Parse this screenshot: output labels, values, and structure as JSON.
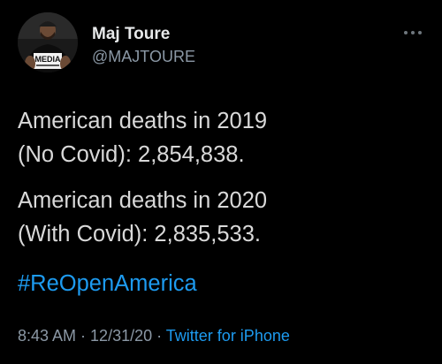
{
  "author": {
    "name": "Maj Toure",
    "handle": "@MAJTOURE",
    "avatar_icon": "profile-photo",
    "avatar_shirt_text": "MEDIA"
  },
  "more_icon": "ellipsis-icon",
  "tweet": {
    "paragraph1": {
      "line1": "American deaths in 2019",
      "line2": "(No Covid): 2,854,838."
    },
    "paragraph2": {
      "line1": "American deaths in 2020",
      "line2": "(With Covid): 2,835,533."
    },
    "hashtag": "#ReOpenAmerica"
  },
  "meta": {
    "time": "8:43 AM",
    "separator": " · ",
    "date": "12/31/20",
    "source": "Twitter for iPhone"
  },
  "colors": {
    "background": "#000000",
    "primary_text": "#e7e9ea",
    "secondary_text": "#8b98a5",
    "link": "#1d9bf0"
  }
}
